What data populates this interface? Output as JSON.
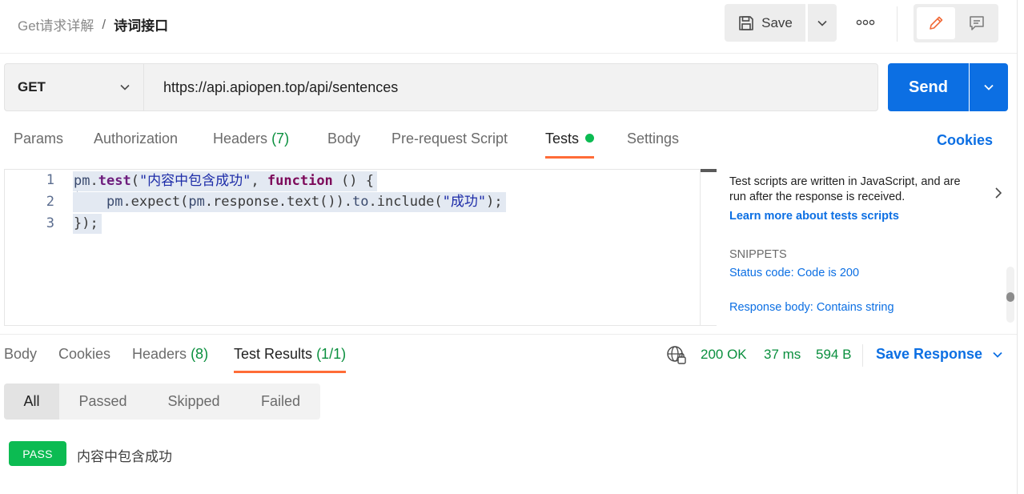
{
  "breadcrumb": {
    "parent": "Get请求详解",
    "separator": "/",
    "current": "诗词接口"
  },
  "toolbar": {
    "save_label": "Save"
  },
  "request": {
    "method": "GET",
    "url": "https://api.apiopen.top/api/sentences",
    "send_label": "Send"
  },
  "request_tabs": {
    "params": "Params",
    "authorization": "Authorization",
    "headers": "Headers",
    "headers_count": "(7)",
    "body": "Body",
    "prerequest": "Pre-request Script",
    "tests": "Tests",
    "settings": "Settings"
  },
  "cookies_link": "Cookies",
  "editor": {
    "line_numbers": [
      "1",
      "2",
      "3"
    ],
    "line1": {
      "obj": "pm",
      "dot": ".",
      "fn": "test",
      "open": "(",
      "str": "\"内容中包含成功\"",
      "comma": ", ",
      "kw": "function",
      "rest": " () {"
    },
    "line2": {
      "indent": "    ",
      "a": "pm",
      "b": ".expect(",
      "c": "pm",
      "d": ".response.text()).",
      "e": "to",
      "f": ".include(",
      "str": "\"成功\"",
      "g": ");"
    },
    "line3": "});"
  },
  "side_panel": {
    "description": "Test scripts are written in JavaScript, and are run after the response is received.",
    "learn_more": "Learn more about tests scripts",
    "snippets_title": "SNIPPETS",
    "snippets": [
      "Status code: Code is 200",
      "Response body: Contains string"
    ]
  },
  "response_tabs": {
    "body": "Body",
    "cookies": "Cookies",
    "headers": "Headers",
    "headers_count": "(8)",
    "test_results": "Test Results",
    "test_results_count": "(1/1)"
  },
  "response_status": {
    "code": "200 OK",
    "time": "37 ms",
    "size": "594 B"
  },
  "save_response": "Save Response",
  "filters": [
    "All",
    "Passed",
    "Skipped",
    "Failed"
  ],
  "results": [
    {
      "status": "PASS",
      "name": "内容中包含成功"
    }
  ],
  "colors": {
    "accent": "#0c6fe3",
    "tab_indicator": "#ff6c37",
    "pass": "#0cbb52",
    "status_ok": "#0a8f3e"
  }
}
